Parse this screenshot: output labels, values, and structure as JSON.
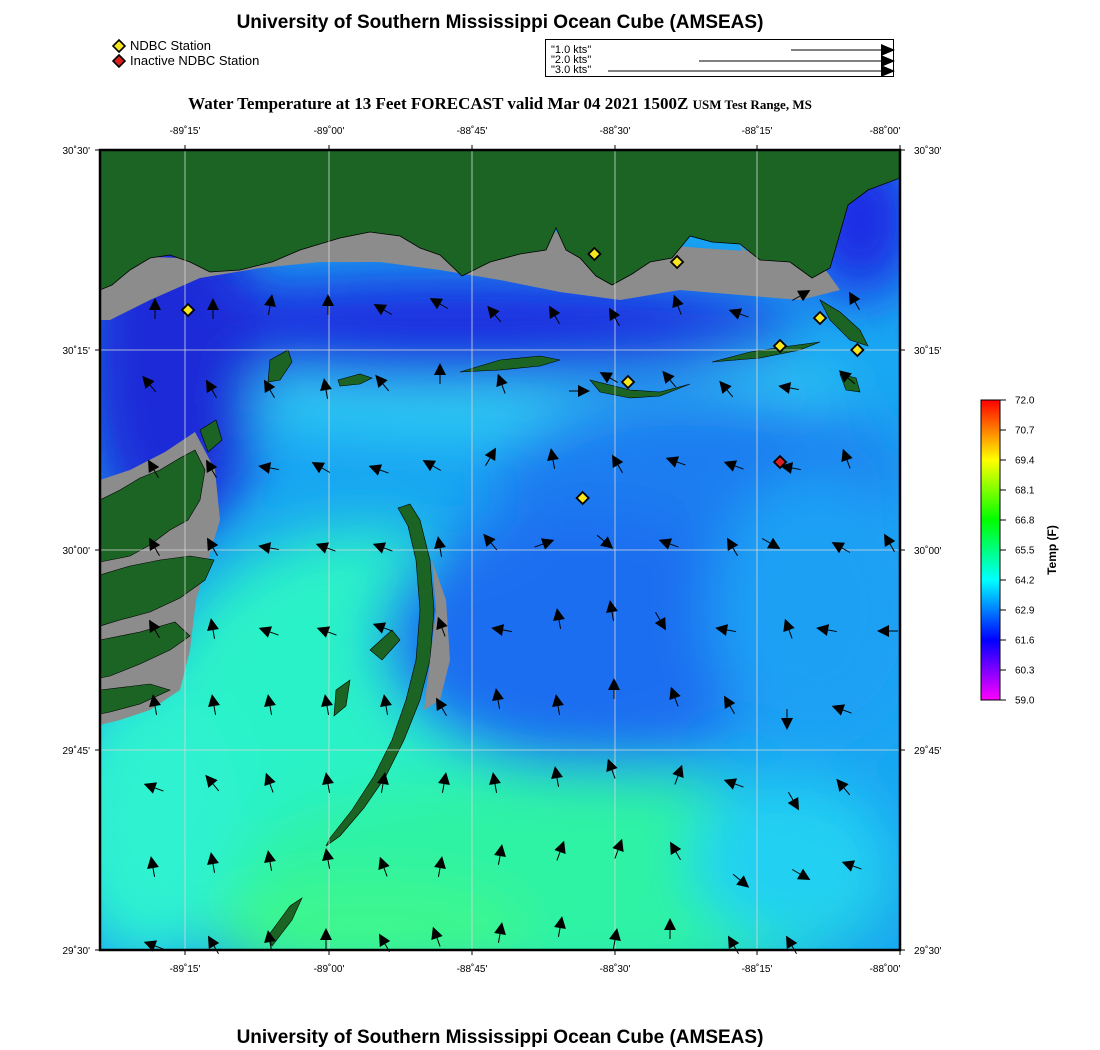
{
  "header": {
    "title": "University of Southern Mississippi Ocean Cube (AMSEAS)"
  },
  "legend": {
    "items": [
      {
        "label": "NDBC Station",
        "color": "#f5e61e"
      },
      {
        "label": "Inactive NDBC Station",
        "color": "#d81e1e"
      }
    ]
  },
  "speed_scale": {
    "items": [
      {
        "label": "1.0 kts",
        "speed_kts": 1.0
      },
      {
        "label": "2.0 kts",
        "speed_kts": 2.0
      },
      {
        "label": "3.0 kts",
        "speed_kts": 3.0
      }
    ]
  },
  "map": {
    "title": "Water Temperature at 13 Feet FORECAST valid Mar 04 2021 1500Z",
    "region": "USM Test Range, MS",
    "lon_labels": [
      "-89˚15'",
      "-89˚00'",
      "-88˚45'",
      "-88˚30'",
      "-88˚15'",
      "-88˚00'"
    ],
    "lat_labels": [
      "30˚30'",
      "30˚15'",
      "30˚00'",
      "29˚45'",
      "29˚30'"
    ],
    "land_color": "#1b6423",
    "marsh_color": "#8c8c8c",
    "stations": [
      {
        "lon": -89.335,
        "lat": 30.3,
        "status": "active"
      },
      {
        "lon": -88.573,
        "lat": 30.37,
        "status": "active"
      },
      {
        "lon": -88.418,
        "lat": 30.36,
        "status": "active"
      },
      {
        "lon": -88.15,
        "lat": 30.29,
        "status": "active"
      },
      {
        "lon": -88.225,
        "lat": 30.255,
        "status": "active"
      },
      {
        "lon": -88.08,
        "lat": 30.25,
        "status": "active"
      },
      {
        "lon": -88.51,
        "lat": 30.21,
        "status": "active"
      },
      {
        "lon": -88.595,
        "lat": 30.065,
        "status": "active"
      },
      {
        "lon": -88.225,
        "lat": 30.11,
        "status": "inactive"
      }
    ]
  },
  "colorbar": {
    "title": "Temp (F)",
    "ticks": [
      "72.0",
      "70.7",
      "69.4",
      "68.1",
      "66.8",
      "65.5",
      "64.2",
      "62.9",
      "61.6",
      "60.3",
      "59.0"
    ]
  },
  "footer": {
    "title": "University of Southern Mississippi Ocean Cube (AMSEAS)"
  }
}
